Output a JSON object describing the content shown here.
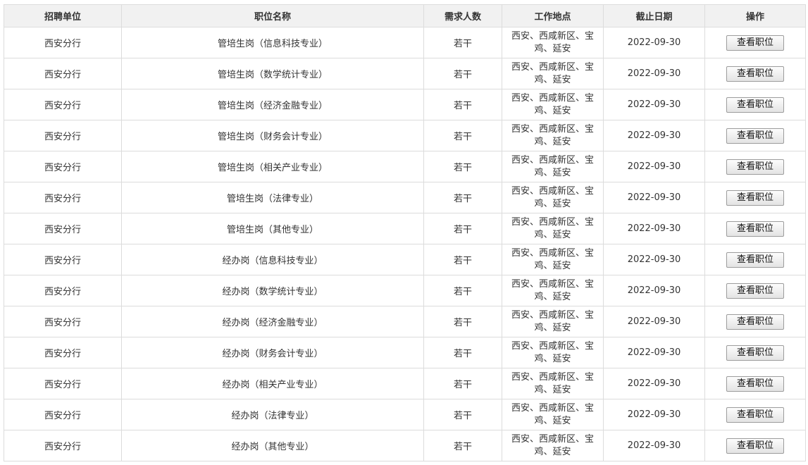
{
  "table": {
    "headers": [
      "招聘单位",
      "职位名称",
      "需求人数",
      "工作地点",
      "截止日期",
      "操作"
    ],
    "button_label": "查看职位",
    "rows": [
      {
        "unit": "西安分行",
        "position": "管培生岗（信息科技专业）",
        "count": "若干",
        "location": "西安、西咸新区、宝鸡、延安",
        "deadline": "2022-09-30"
      },
      {
        "unit": "西安分行",
        "position": "管培生岗（数学统计专业）",
        "count": "若干",
        "location": "西安、西咸新区、宝鸡、延安",
        "deadline": "2022-09-30"
      },
      {
        "unit": "西安分行",
        "position": "管培生岗（经济金融专业）",
        "count": "若干",
        "location": "西安、西咸新区、宝鸡、延安",
        "deadline": "2022-09-30"
      },
      {
        "unit": "西安分行",
        "position": "管培生岗（财务会计专业）",
        "count": "若干",
        "location": "西安、西咸新区、宝鸡、延安",
        "deadline": "2022-09-30"
      },
      {
        "unit": "西安分行",
        "position": "管培生岗（相关产业专业）",
        "count": "若干",
        "location": "西安、西咸新区、宝鸡、延安",
        "deadline": "2022-09-30"
      },
      {
        "unit": "西安分行",
        "position": "管培生岗（法律专业）",
        "count": "若干",
        "location": "西安、西咸新区、宝鸡、延安",
        "deadline": "2022-09-30"
      },
      {
        "unit": "西安分行",
        "position": "管培生岗（其他专业）",
        "count": "若干",
        "location": "西安、西咸新区、宝鸡、延安",
        "deadline": "2022-09-30"
      },
      {
        "unit": "西安分行",
        "position": "经办岗（信息科技专业）",
        "count": "若干",
        "location": "西安、西咸新区、宝鸡、延安",
        "deadline": "2022-09-30"
      },
      {
        "unit": "西安分行",
        "position": "经办岗（数学统计专业）",
        "count": "若干",
        "location": "西安、西咸新区、宝鸡、延安",
        "deadline": "2022-09-30"
      },
      {
        "unit": "西安分行",
        "position": "经办岗（经济金融专业）",
        "count": "若干",
        "location": "西安、西咸新区、宝鸡、延安",
        "deadline": "2022-09-30"
      },
      {
        "unit": "西安分行",
        "position": "经办岗（财务会计专业）",
        "count": "若干",
        "location": "西安、西咸新区、宝鸡、延安",
        "deadline": "2022-09-30"
      },
      {
        "unit": "西安分行",
        "position": "经办岗（相关产业专业）",
        "count": "若干",
        "location": "西安、西咸新区、宝鸡、延安",
        "deadline": "2022-09-30"
      },
      {
        "unit": "西安分行",
        "position": "经办岗（法律专业）",
        "count": "若干",
        "location": "西安、西咸新区、宝鸡、延安",
        "deadline": "2022-09-30"
      },
      {
        "unit": "西安分行",
        "position": "经办岗（其他专业）",
        "count": "若干",
        "location": "西安、西咸新区、宝鸡、延安",
        "deadline": "2022-09-30"
      }
    ]
  }
}
